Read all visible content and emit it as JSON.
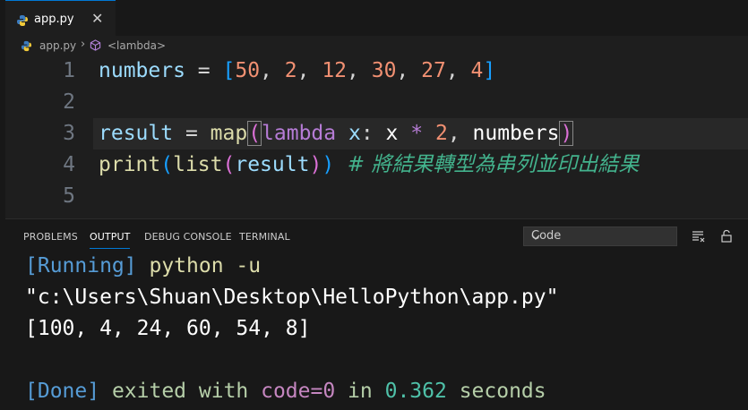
{
  "tab": {
    "filename": "app.py",
    "close_glyph": "✕"
  },
  "breadcrumb": {
    "file": "app.py",
    "separator": "›",
    "symbol": "<lambda>"
  },
  "editor": {
    "line_numbers": [
      "1",
      "2",
      "3",
      "4",
      "5"
    ],
    "line1": {
      "var": "numbers",
      "eq": " = ",
      "open": "[",
      "n1": "50",
      "c1": ", ",
      "n2": "2",
      "c2": ", ",
      "n3": "12",
      "c3": ", ",
      "n4": "30",
      "c4": ", ",
      "n5": "27",
      "c5": ", ",
      "n6": "4",
      "close": "]"
    },
    "line3": {
      "var": "result",
      "eq": " = ",
      "fn": "map",
      "open": "(",
      "kw": "lambda",
      "param": " x",
      "colon": ": ",
      "x": "x",
      "mul": " * ",
      "num": "2",
      "comma": ", ",
      "arg": "numbers",
      "close": ")"
    },
    "line4": {
      "fn1": "print",
      "o1": "(",
      "fn2": "list",
      "o2": "(",
      "arg": "result",
      "c2": ")",
      "c1": ")",
      "comment": "  # 將結果轉型為串列並印出結果"
    }
  },
  "panel": {
    "tabs": [
      "PROBLEMS",
      "OUTPUT",
      "DEBUG CONSOLE",
      "TERMINAL"
    ],
    "active_tab": "OUTPUT",
    "select_value": "Code",
    "output": {
      "running_tag": "[Running]",
      "command": " python -u",
      "path": "\"c:\\Users\\Shuan\\Desktop\\HelloPython\\app.py\"",
      "result": "[100, 4, 24, 60, 54, 8]",
      "done_tag": "[Done]",
      "exited": " exited with ",
      "code_label": "code=0",
      "in_word": " in ",
      "duration": "0.362",
      "seconds": " seconds"
    }
  },
  "colors": {
    "accent": "#0078d4",
    "editor_bg": "#1e1e1e",
    "panel_bg": "#181818"
  },
  "icons": [
    "python-file-icon",
    "close-icon",
    "lambda-symbol-icon",
    "chevron-down-icon",
    "clear-output-icon",
    "lock-scroll-icon"
  ]
}
